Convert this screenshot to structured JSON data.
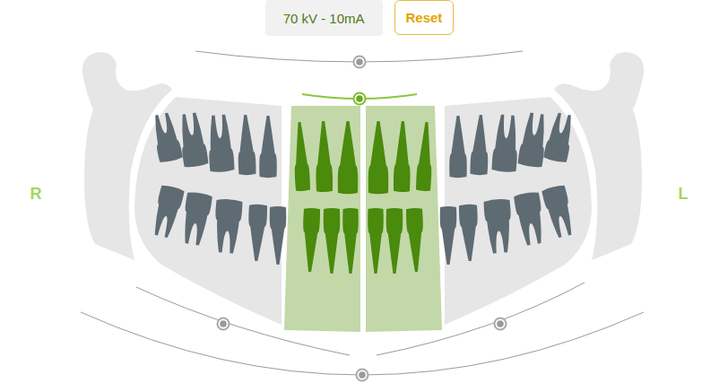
{
  "exposure": "70 kV - 10mA",
  "reset": {
    "label": "Reset"
  },
  "sides": {
    "right": "R",
    "left": "L"
  },
  "segments": [
    {
      "selected": false
    },
    {
      "selected": true
    },
    {
      "selected": true
    },
    {
      "selected": false
    }
  ],
  "handles": [
    {
      "selected": false
    },
    {
      "selected": true
    },
    {
      "selected": false
    },
    {
      "selected": false
    },
    {
      "selected": false
    }
  ]
}
